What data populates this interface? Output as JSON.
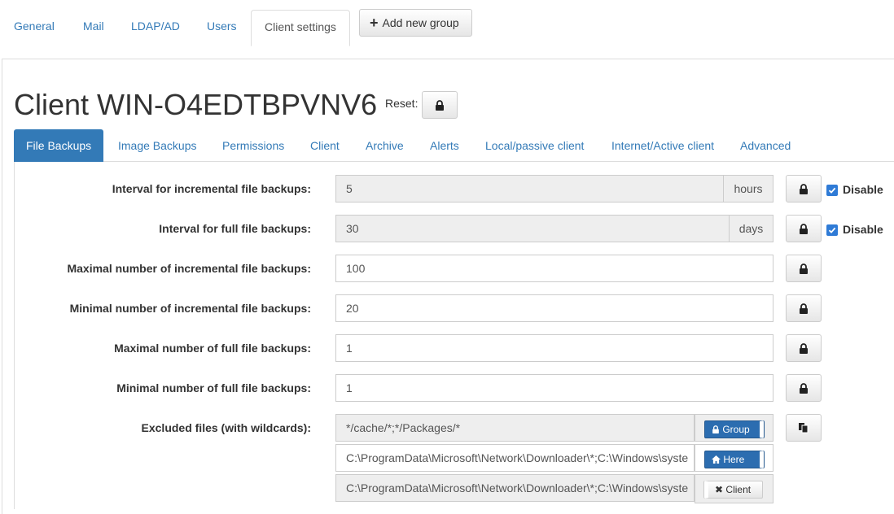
{
  "nav": {
    "tabs": [
      "General",
      "Mail",
      "LDAP/AD",
      "Users",
      "Client settings"
    ],
    "active": "Client settings",
    "add_group_label": "Add new group"
  },
  "client": {
    "title": "Client WIN-O4EDTBPVNV6",
    "reset_label": "Reset:"
  },
  "subtabs": [
    "File Backups",
    "Image Backups",
    "Permissions",
    "Client",
    "Archive",
    "Alerts",
    "Local/passive client",
    "Internet/Active client",
    "Advanced"
  ],
  "settings": [
    {
      "label": "Interval for incremental file backups:",
      "value": "5",
      "unit": "hours",
      "disable_label": "Disable",
      "disabled": true
    },
    {
      "label": "Interval for full file backups:",
      "value": "30",
      "unit": "days",
      "disable_label": "Disable",
      "disabled": true
    },
    {
      "label": "Maximal number of incremental file backups:",
      "value": "100"
    },
    {
      "label": "Minimal number of incremental file backups:",
      "value": "20"
    },
    {
      "label": "Maximal number of full file backups:",
      "value": "1"
    },
    {
      "label": "Minimal number of full file backups:",
      "value": "1"
    }
  ],
  "excluded": {
    "label": "Excluded files (with wildcards):",
    "group_value": "*/cache/*;*/Packages/*",
    "here_value": "C:\\ProgramData\\Microsoft\\Network\\Downloader\\*;C:\\Windows\\syste",
    "client_value": "C:\\ProgramData\\Microsoft\\Network\\Downloader\\*;C:\\Windows\\syste",
    "group_btn": "Group",
    "here_btn": "Here",
    "client_btn": "Client"
  },
  "colors": {
    "accent": "#337ab7",
    "checkbox": "#2f7bd6"
  },
  "icons": {
    "lock": "lock-icon",
    "copy": "copy-icon",
    "plus": "plus-icon",
    "home": "home-icon",
    "times": "times-icon"
  }
}
